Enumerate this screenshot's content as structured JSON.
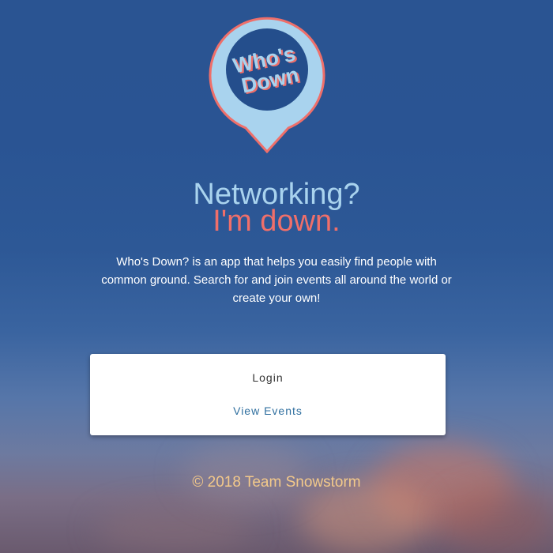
{
  "logo": {
    "line1": "Who's",
    "line2": "Down",
    "icon": "map-pin-logo"
  },
  "hero": {
    "title_line1": "Networking?",
    "title_line2": "I'm down.",
    "description": "Who's Down? is an app that helps you easily find people with common ground. Search for and join events all around the world or create your own!"
  },
  "actions": {
    "login_label": "Login",
    "view_events_label": "View Events"
  },
  "footer": {
    "copyright": "© 2018 Team Snowstorm"
  },
  "colors": {
    "accent_blue": "#a9d3ee",
    "accent_coral": "#ef6f6a",
    "link_blue": "#2f6f9f",
    "footer_gold": "#f3c98a"
  }
}
